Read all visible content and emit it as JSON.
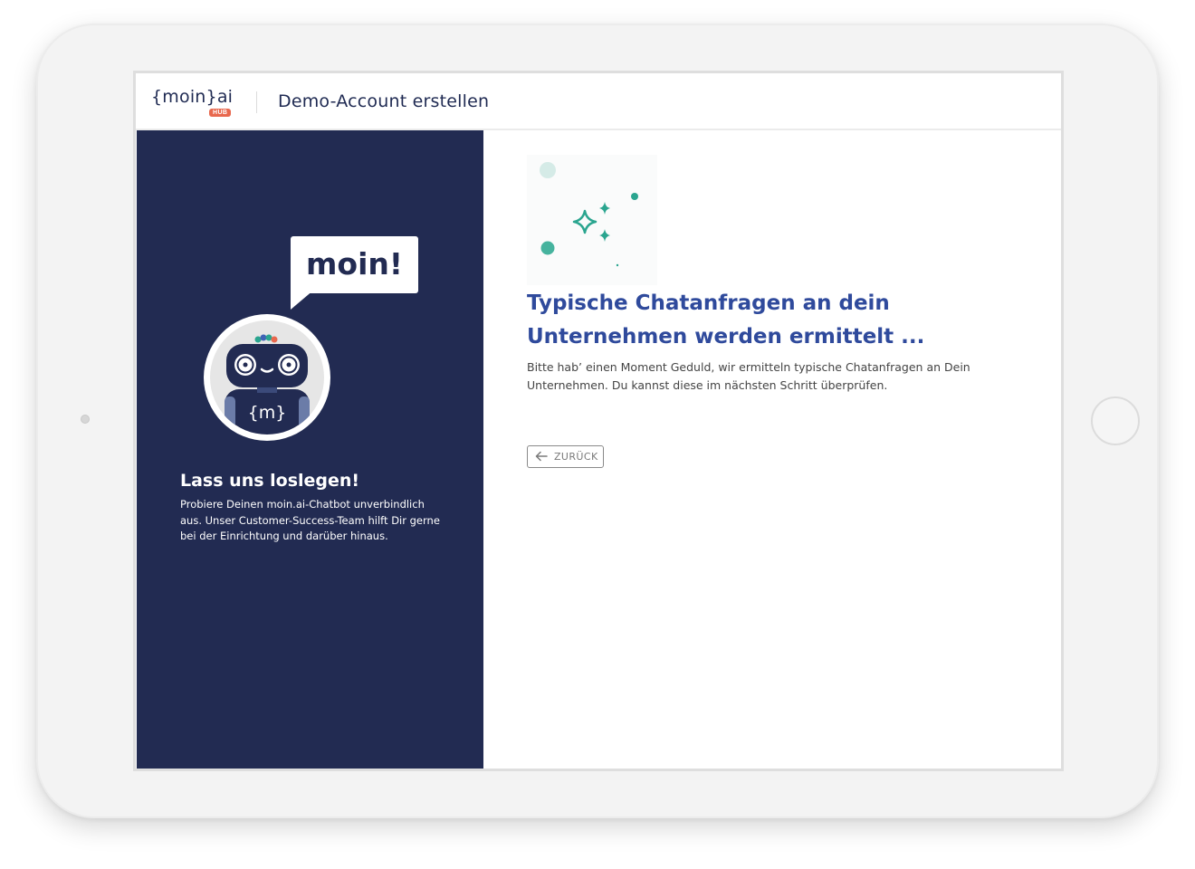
{
  "header": {
    "logo_text": "{moin}ai",
    "logo_badge": "HUB",
    "title": "Demo-Account erstellen"
  },
  "left_panel": {
    "speech_bubble": "moin!",
    "robot_chest_text": "{m}",
    "title": "Lass uns loslegen!",
    "description": "Probiere Deinen moin.ai-Chatbot unverbindlich aus. Unser Customer-Success-Team hilft Dir gerne bei der Einrichtung und darüber hinaus."
  },
  "main": {
    "illustration_icon": "sparkles-icon",
    "heading": "Typische Chatanfragen an dein Unternehmen werden ermittelt ...",
    "description": "Bitte hab’ einen Moment Geduld, wir ermitteln typische Chatanfragen an Dein Unternehmen. Du kannst diese im nächsten Schritt überprüfen.",
    "back_button_label": "ZURÜCK",
    "back_button_icon": "arrow-left-icon"
  },
  "colors": {
    "navy": "#222b52",
    "heading_blue": "#2f4a9c",
    "teal": "#2aa58f",
    "badge_orange": "#e8684e"
  }
}
